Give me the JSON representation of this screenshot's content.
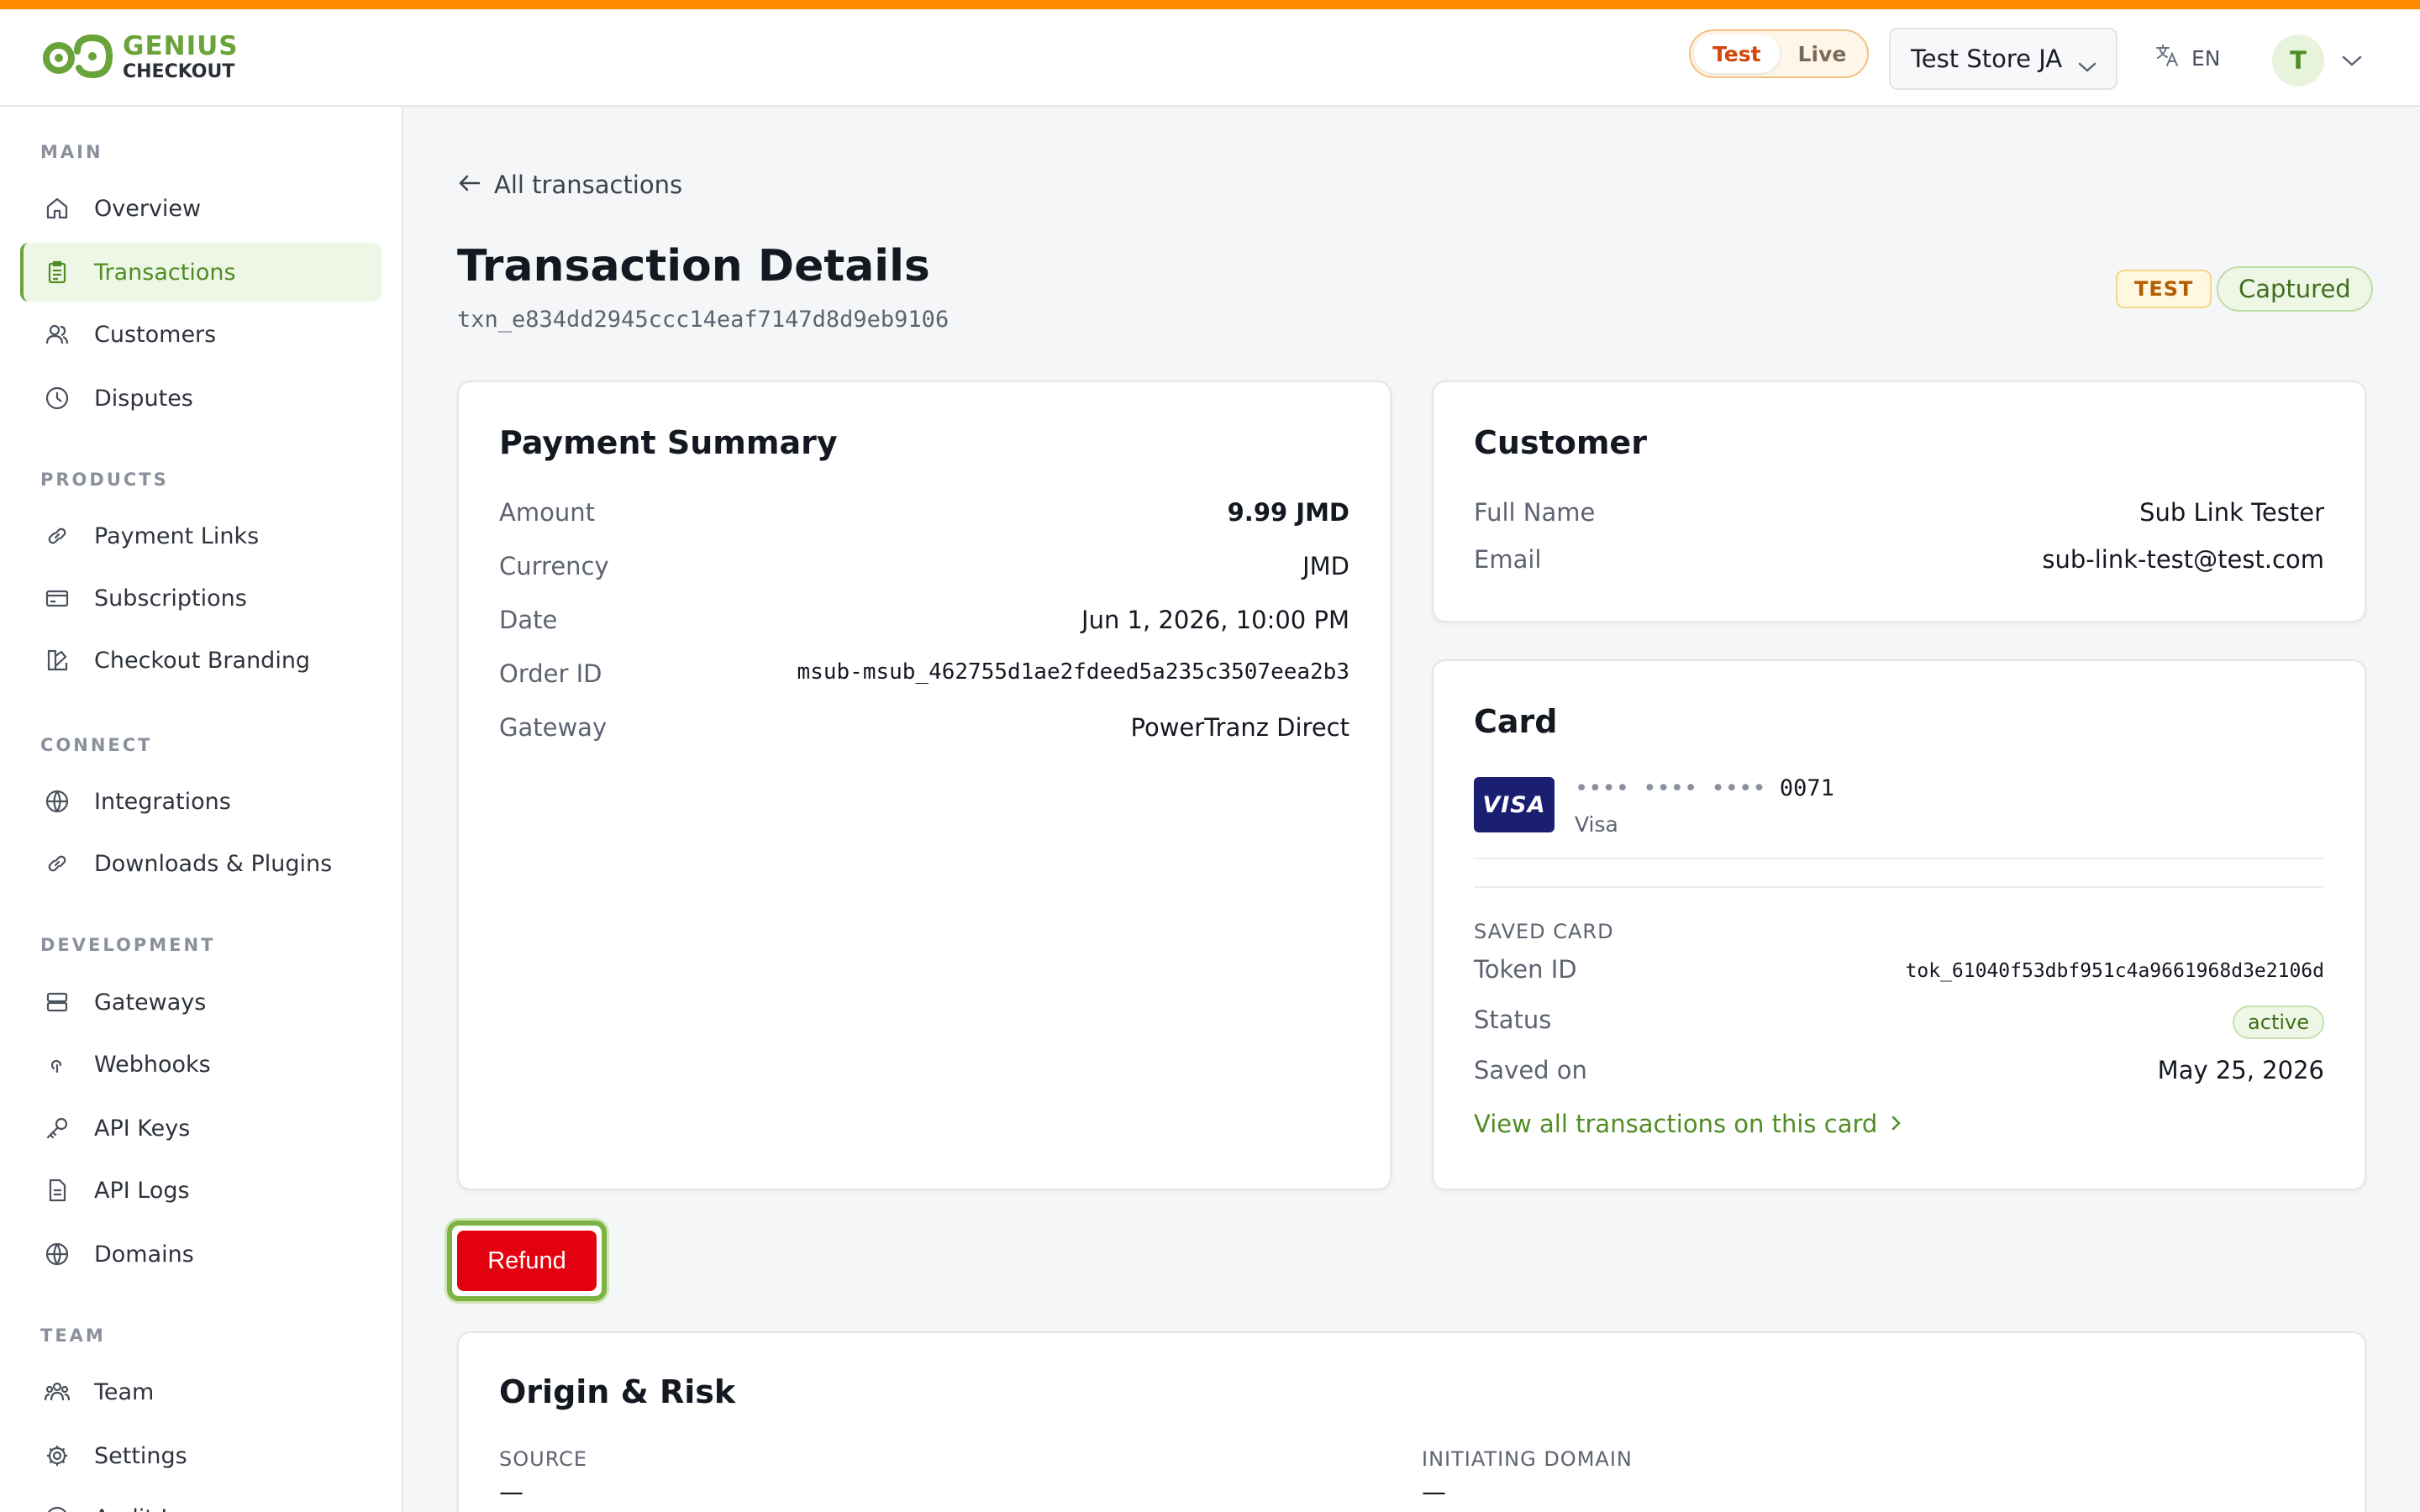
{
  "brand": {
    "line1": "GENIUS",
    "line2": "CHECKOUT",
    "accent_color": "#6aa339",
    "top_stripe_color": "#ff8a00"
  },
  "header": {
    "mode_toggle": {
      "options": [
        "Test",
        "Live"
      ],
      "selected": "Test"
    },
    "store_select": {
      "value": "Test Store JA"
    },
    "language": {
      "icon": "translate-icon",
      "label": "EN"
    },
    "avatar": {
      "initial": "T"
    }
  },
  "sidebar": {
    "sections": [
      {
        "label": "MAIN",
        "items": [
          {
            "label": "Overview",
            "icon": "home-icon"
          },
          {
            "label": "Transactions",
            "icon": "receipt-icon",
            "active": true
          },
          {
            "label": "Customers",
            "icon": "users-icon"
          },
          {
            "label": "Disputes",
            "icon": "clock-icon"
          }
        ]
      },
      {
        "label": "PRODUCTS",
        "items": [
          {
            "label": "Payment Links",
            "icon": "link-icon"
          },
          {
            "label": "Subscriptions",
            "icon": "credit-card-icon"
          },
          {
            "label": "Checkout Branding",
            "icon": "palette-icon"
          }
        ]
      },
      {
        "label": "CONNECT",
        "items": [
          {
            "label": "Integrations",
            "icon": "globe-icon"
          },
          {
            "label": "Downloads & Plugins",
            "icon": "link-icon"
          }
        ]
      },
      {
        "label": "DEVELOPMENT",
        "items": [
          {
            "label": "Gateways",
            "icon": "server-icon"
          },
          {
            "label": "Webhooks",
            "icon": "webhook-icon"
          },
          {
            "label": "API Keys",
            "icon": "key-icon"
          },
          {
            "label": "API Logs",
            "icon": "file-text-icon"
          },
          {
            "label": "Domains",
            "icon": "globe-icon"
          }
        ]
      },
      {
        "label": "TEAM",
        "items": [
          {
            "label": "Team",
            "icon": "team-icon"
          },
          {
            "label": "Settings",
            "icon": "gear-icon"
          },
          {
            "label": "Audit Log",
            "icon": "audit-icon"
          }
        ]
      }
    ]
  },
  "main": {
    "back_link": "All transactions",
    "title": "Transaction Details",
    "transaction_id": "txn_e834dd2945ccc14eaf7147d8d9eb9106",
    "badges": {
      "mode": "TEST",
      "status": "Captured"
    },
    "payment_summary": {
      "title": "Payment Summary",
      "rows": [
        {
          "label": "Amount",
          "value": "9.99 JMD"
        },
        {
          "label": "Currency",
          "value": "JMD"
        },
        {
          "label": "Date",
          "value": "Jun 1, 2026, 10:00 PM"
        },
        {
          "label": "Order ID",
          "value": "msub-msub_462755d1ae2fdeed5a235c3507eea2b3"
        },
        {
          "label": "Gateway",
          "value": "PowerTranz Direct"
        }
      ]
    },
    "customer": {
      "title": "Customer",
      "rows": [
        {
          "label": "Full Name",
          "value": "Sub Link Tester"
        },
        {
          "label": "Email",
          "value": "sub-link-test@test.com"
        }
      ]
    },
    "card": {
      "title": "Card",
      "brand_logo": "VISA",
      "mask": "•••• •••• ••••",
      "last4": "0071",
      "brand": "Visa",
      "saved_card_label": "SAVED CARD",
      "rows": [
        {
          "label": "Token ID",
          "value": "tok_61040f53dbf951c4a9661968d3e2106d"
        },
        {
          "label": "Status",
          "value": "active"
        },
        {
          "label": "Saved on",
          "value": "May 25, 2026"
        }
      ],
      "link": "View all transactions on this card"
    },
    "refund_button": "Refund",
    "origin_risk": {
      "title": "Origin & Risk",
      "columns": [
        {
          "label": "SOURCE",
          "value": "—"
        },
        {
          "label": "INITIATING DOMAIN",
          "value": "—"
        }
      ]
    }
  }
}
